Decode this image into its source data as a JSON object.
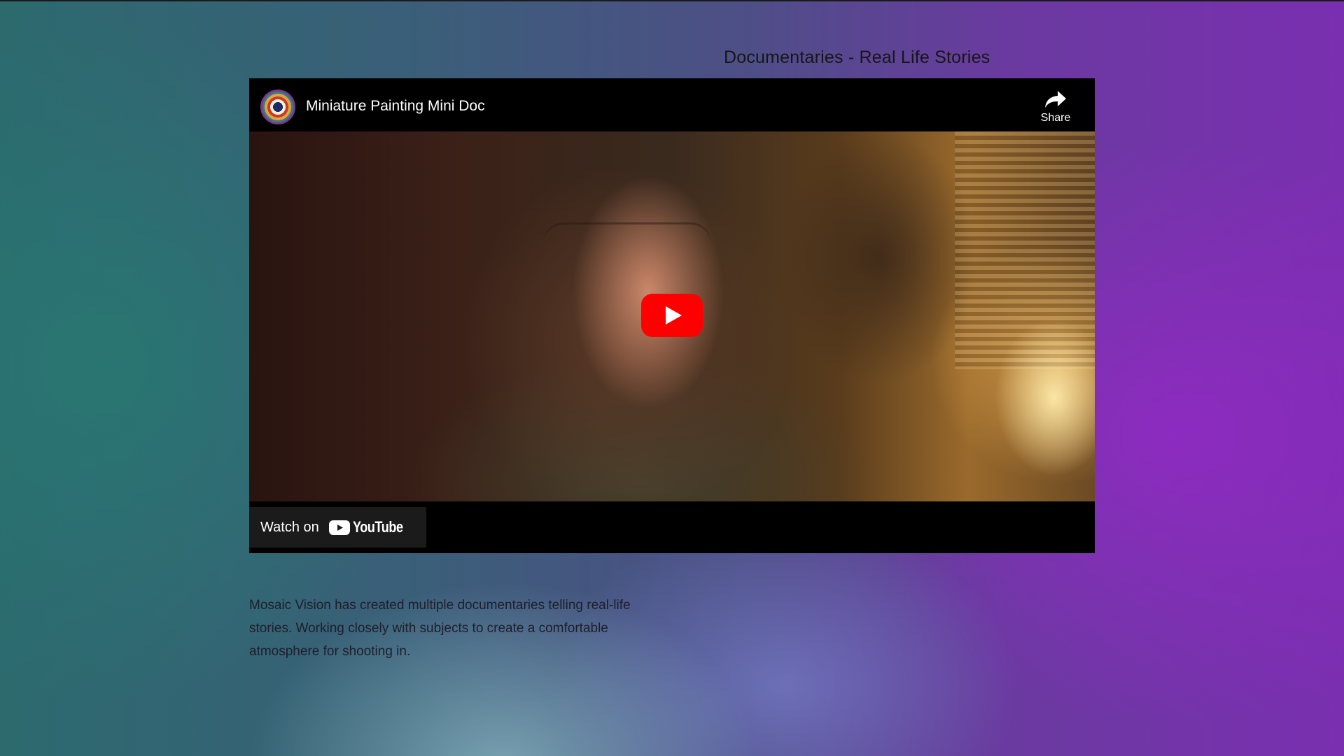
{
  "page": {
    "title": "Documentaries - Real Life Stories",
    "description": "Mosaic Vision has created multiple documentaries telling real-life stories. Working closely with subjects to create a comfortable atmosphere for shooting in."
  },
  "video": {
    "title": "Miniature Painting Mini Doc",
    "share_label": "Share",
    "watch_on_label": "Watch on",
    "youtube_wordmark": "YouTube",
    "icons": {
      "channel": "channel-avatar",
      "share": "share-arrow-icon",
      "play": "play-button-icon",
      "youtube": "youtube-logo-icon"
    }
  },
  "colors": {
    "youtube_red": "#ff0000",
    "video_bg": "#000000",
    "text_dark": "#161616"
  }
}
